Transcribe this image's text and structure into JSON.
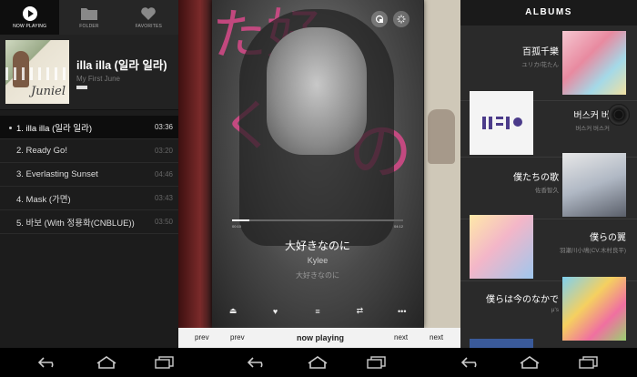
{
  "left": {
    "tabs": [
      {
        "label": "NOW PLAYING",
        "icon": "play-circle-icon"
      },
      {
        "label": "FOLDER",
        "icon": "folder-icon"
      },
      {
        "label": "FAVORITES",
        "icon": "heart-icon"
      }
    ],
    "album": {
      "title": "illa illa (일라 일라)",
      "artist": "My First June",
      "cover_text": "Juniel"
    },
    "tracks": [
      {
        "title": "1. illa illa (일라 일라)",
        "duration": "03:36",
        "current": true
      },
      {
        "title": "2. Ready Go!",
        "duration": "03:20",
        "current": false
      },
      {
        "title": "3. Everlasting Sunset",
        "duration": "04:46",
        "current": false
      },
      {
        "title": "4. Mask (가면)",
        "duration": "03:43",
        "current": false
      },
      {
        "title": "5. 바보 (With 정용화(CNBLUE))",
        "duration": "03:50",
        "current": false
      }
    ]
  },
  "middle": {
    "song_title": "大好きなのに",
    "artist": "Kylee",
    "album": "大好きなのに",
    "progress": 0.1,
    "time_elapsed": "00:10",
    "time_total": "04:12",
    "bottom_bar": {
      "prev_left": "prev",
      "prev": "prev",
      "now_playing": "now playing",
      "next": "next",
      "next_right": "next"
    },
    "colors": {
      "accent": "#d94a8a"
    }
  },
  "right": {
    "header": "ALBUMS",
    "albums": [
      {
        "title": "百孤千樂",
        "artist": "ユリカ/花たん"
      },
      {
        "title": "버스커 버",
        "artist": "버스커 버스커"
      },
      {
        "title": "僕たちの歌",
        "artist": "佐香智久"
      },
      {
        "title": "僕らの翼",
        "artist": "羽瀬川小鳩(CV.木村良平)"
      },
      {
        "title": "僕らは今のなかで",
        "artist": "μ's"
      }
    ]
  }
}
